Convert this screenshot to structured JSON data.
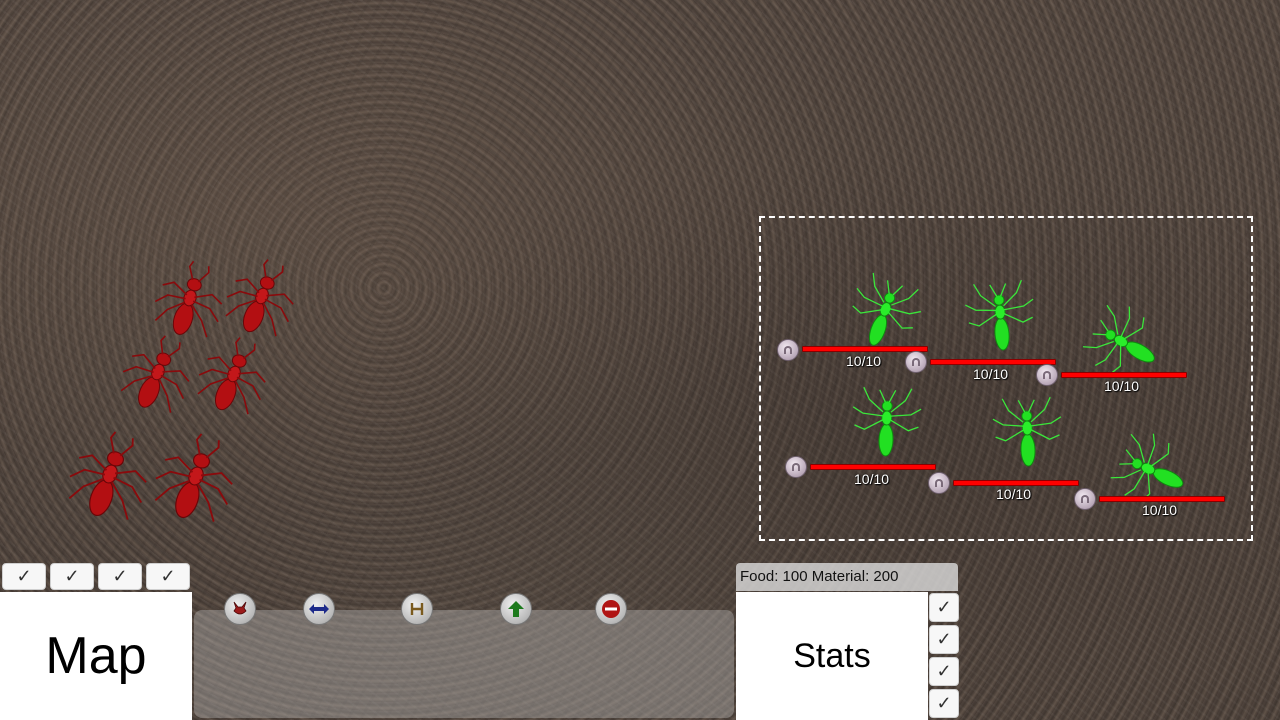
{
  "game": {
    "colors": {
      "enemy_ant": "#b30f12",
      "player_ant": "#22e022",
      "hp_bar": "#ff0000",
      "selection_border": "#ffffff"
    },
    "enemy_ants_count": 6,
    "selected_units": [
      {
        "hp": "10/10",
        "icon": "unit-type-icon"
      },
      {
        "hp": "10/10",
        "icon": "unit-type-icon"
      },
      {
        "hp": "10/10",
        "icon": "unit-type-icon"
      },
      {
        "hp": "10/10",
        "icon": "unit-type-icon"
      },
      {
        "hp": "10/10",
        "icon": "unit-type-icon"
      },
      {
        "hp": "10/10",
        "icon": "unit-type-icon"
      }
    ]
  },
  "hud": {
    "map_label": "Map",
    "stats_label": "Stats",
    "resources": "Food: 100 Material: 200",
    "map_toggles": [
      "✓",
      "✓",
      "✓",
      "✓"
    ],
    "stats_toggles": [
      "✓",
      "✓",
      "✓",
      "✓"
    ],
    "commands": [
      {
        "name": "attack-command",
        "icon": "ant-head-icon"
      },
      {
        "name": "move-command",
        "icon": "double-arrow-icon"
      },
      {
        "name": "hold-command",
        "icon": "hold-icon"
      },
      {
        "name": "upgrade-command",
        "icon": "up-arrow-icon"
      },
      {
        "name": "stop-command",
        "icon": "stop-icon"
      }
    ]
  }
}
